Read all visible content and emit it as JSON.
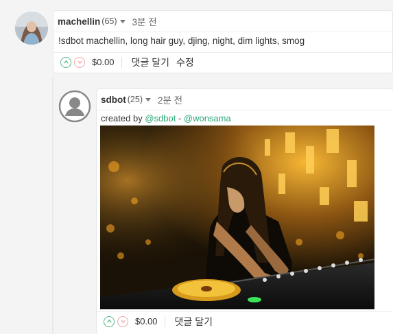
{
  "comments": [
    {
      "author": "machellin",
      "reputation": "(65)",
      "time": "3분 전",
      "body": "!sdbot machellin, long hair guy, djing, night, dim lights, smog",
      "payout": "$0.00",
      "actions": [
        "댓글 달기",
        "수정"
      ]
    },
    {
      "author": "sdbot",
      "reputation": "(25)",
      "time": "2분 전",
      "created_prefix": "created by ",
      "created_by": "@sdbot",
      "separator": " - ",
      "created_for": "@wonsama",
      "payout": "$0.00",
      "actions": [
        "댓글 달기"
      ]
    }
  ],
  "colors": {
    "link": "#2aa876",
    "upvote": "#5bb58a",
    "downvote": "#f2a6a6"
  },
  "icons": [
    "upvote-icon",
    "downvote-icon",
    "caret-down-icon",
    "default-avatar-icon"
  ]
}
